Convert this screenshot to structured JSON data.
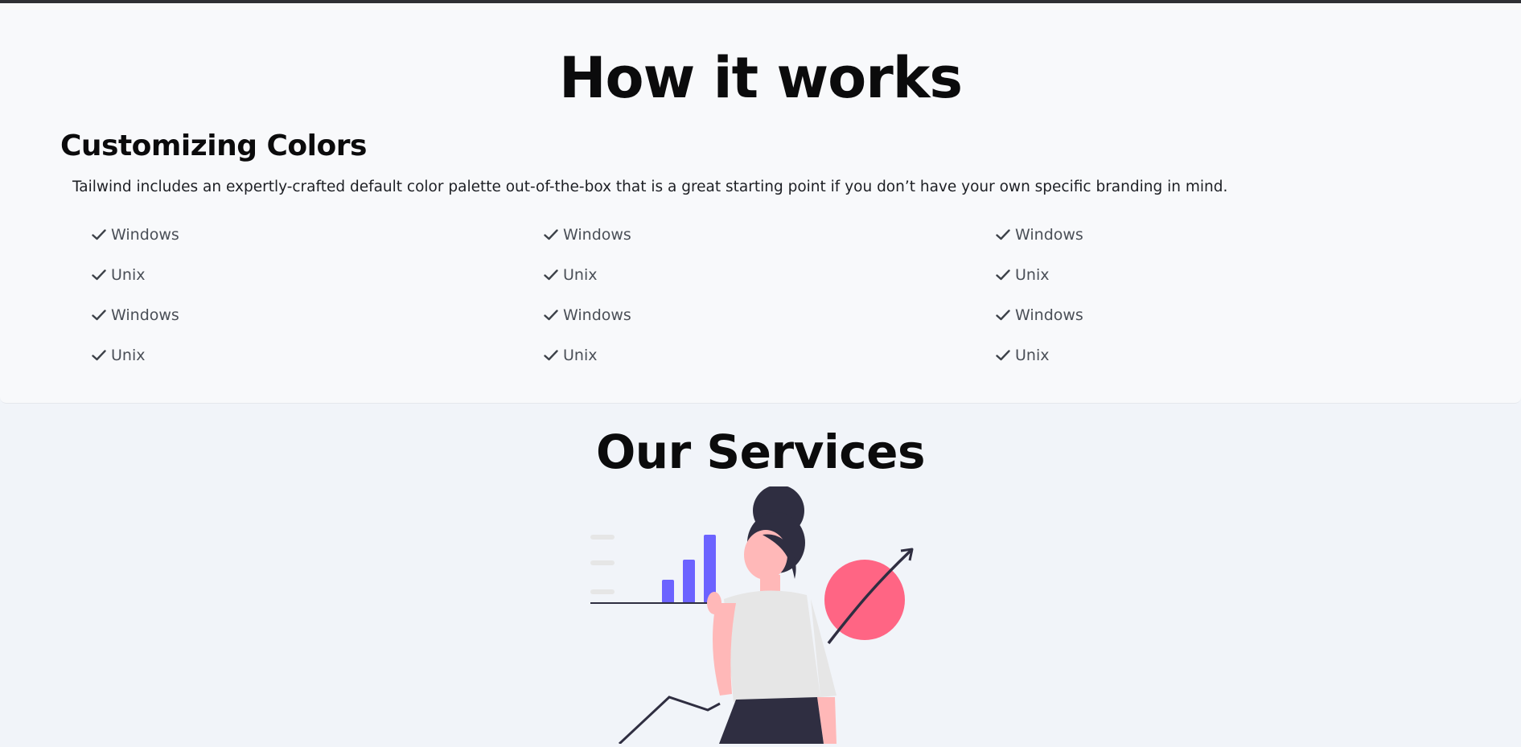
{
  "how_it_works": {
    "title": "How it works",
    "subtitle": "Customizing Colors",
    "description": "Tailwind includes an expertly-crafted default color palette out-of-the-box that is a great starting point if you don’t have your own specific branding in mind.",
    "columns": [
      {
        "items": [
          "Windows",
          "Unix",
          "Windows",
          "Unix"
        ]
      },
      {
        "items": [
          "Windows",
          "Unix",
          "Windows",
          "Unix"
        ]
      },
      {
        "items": [
          "Windows",
          "Unix",
          "Windows",
          "Unix"
        ]
      }
    ],
    "item_icon": "check-icon"
  },
  "services": {
    "title": "Our Services",
    "illustration": "woman-presenting-growth-chart-illustration"
  },
  "colors": {
    "bar_accent": "#6c63ff",
    "circle_accent": "#ff6584",
    "dark": "#2f2e41",
    "page_bg": "#f1f4f9",
    "card_bg": "#f8f9fb"
  }
}
